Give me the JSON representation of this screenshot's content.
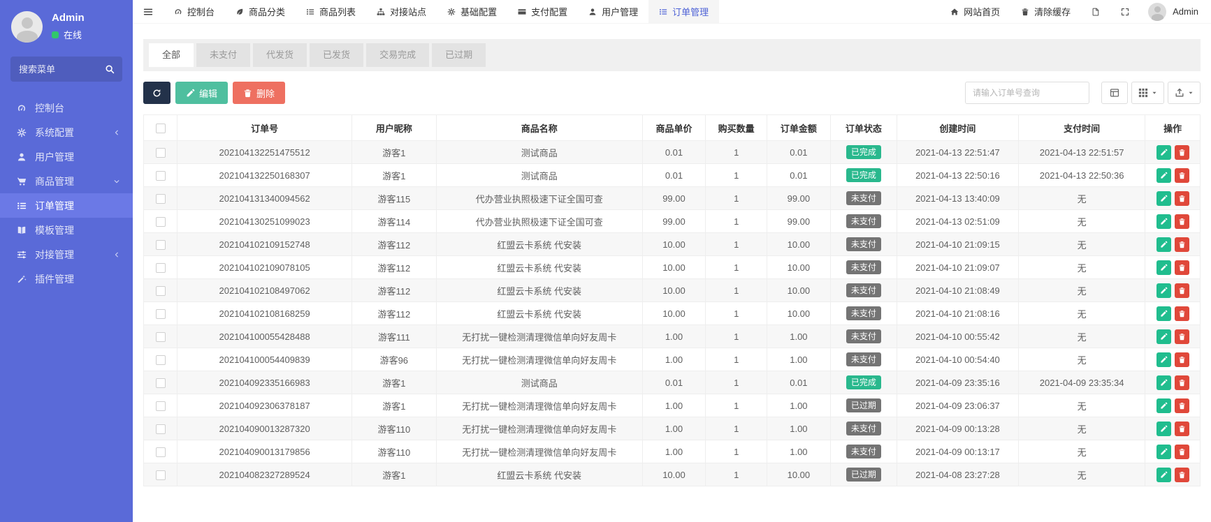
{
  "colors": {
    "sidebar_bg": "#5a6ad8",
    "sidebar_active_bg": "#6b79e6",
    "topbar_active_text": "#4f63d6",
    "success_badge": "#29b88d",
    "gray_badge": "#747474",
    "edit_button": "#4fbf9f",
    "delete_button": "#ee7061",
    "refresh_button": "#23324a",
    "action_edit": "#20bd8e",
    "action_delete": "#e0483a",
    "online_dot": "#31c76b"
  },
  "sidebar": {
    "user": {
      "name": "Admin",
      "status": "在线"
    },
    "search_placeholder": "搜索菜单",
    "items": [
      {
        "key": "console",
        "label": "控制台",
        "icon": "dashboard-icon",
        "arrow": "none",
        "active": false
      },
      {
        "key": "system-config",
        "label": "系统配置",
        "icon": "gear-icon",
        "arrow": "left",
        "active": false
      },
      {
        "key": "user-manage",
        "label": "用户管理",
        "icon": "user-icon",
        "arrow": "none",
        "active": false
      },
      {
        "key": "goods-manage",
        "label": "商品管理",
        "icon": "cart-icon",
        "arrow": "down",
        "active": false
      },
      {
        "key": "order-manage",
        "label": "订单管理",
        "icon": "list-icon",
        "arrow": "none",
        "active": true
      },
      {
        "key": "template-manage",
        "label": "模板管理",
        "icon": "book-icon",
        "arrow": "none",
        "active": false
      },
      {
        "key": "integration-manage",
        "label": "对接管理",
        "icon": "sliders-icon",
        "arrow": "left",
        "active": false
      },
      {
        "key": "plugin-manage",
        "label": "插件管理",
        "icon": "wand-icon",
        "arrow": "none",
        "active": false
      }
    ]
  },
  "topbar": {
    "menu": [
      {
        "key": "console",
        "label": "控制台",
        "icon": "dashboard-icon",
        "active": false
      },
      {
        "key": "goods-category",
        "label": "商品分类",
        "icon": "category-icon",
        "active": false
      },
      {
        "key": "goods-list",
        "label": "商品列表",
        "icon": "list-icon",
        "active": false
      },
      {
        "key": "sites",
        "label": "对接站点",
        "icon": "sitemap-icon",
        "active": false
      },
      {
        "key": "base-config",
        "label": "基础配置",
        "icon": "gear-icon",
        "active": false
      },
      {
        "key": "pay-config",
        "label": "支付配置",
        "icon": "card-icon",
        "active": false
      },
      {
        "key": "user-manage",
        "label": "用户管理",
        "icon": "user-icon",
        "active": false
      },
      {
        "key": "order-manage",
        "label": "订单管理",
        "icon": "list-icon",
        "active": true
      }
    ],
    "right": {
      "home_label": "网站首页",
      "clear_cache_label": "清除缓存",
      "user_label": "Admin"
    }
  },
  "tabs": [
    {
      "key": "all",
      "label": "全部",
      "active": true
    },
    {
      "key": "unpaid",
      "label": "未支付",
      "active": false
    },
    {
      "key": "to-ship",
      "label": "代发货",
      "active": false
    },
    {
      "key": "shipped",
      "label": "已发货",
      "active": false
    },
    {
      "key": "completed",
      "label": "交易完成",
      "active": false
    },
    {
      "key": "expired",
      "label": "已过期",
      "active": false
    }
  ],
  "toolbar": {
    "edit_label": "编辑",
    "delete_label": "删除",
    "search_placeholder": "请输入订单号查询"
  },
  "table": {
    "columns": [
      "订单号",
      "用户昵称",
      "商品名称",
      "商品单价",
      "购买数量",
      "订单金额",
      "订单状态",
      "创建时间",
      "支付时间",
      "操作"
    ],
    "rows": [
      {
        "order_no": "202104132251475512",
        "nickname": "游客1",
        "product": "测试商品",
        "price": "0.01",
        "qty": "1",
        "amount": "0.01",
        "status": "已完成",
        "status_type": "done",
        "created": "2021-04-13 22:51:47",
        "paid": "2021-04-13 22:51:57"
      },
      {
        "order_no": "202104132250168307",
        "nickname": "游客1",
        "product": "测试商品",
        "price": "0.01",
        "qty": "1",
        "amount": "0.01",
        "status": "已完成",
        "status_type": "done",
        "created": "2021-04-13 22:50:16",
        "paid": "2021-04-13 22:50:36"
      },
      {
        "order_no": "202104131340094562",
        "nickname": "游客115",
        "product": "代办营业执照极速下证全国可查",
        "price": "99.00",
        "qty": "1",
        "amount": "99.00",
        "status": "未支付",
        "status_type": "unpaid",
        "created": "2021-04-13 13:40:09",
        "paid": "无"
      },
      {
        "order_no": "202104130251099023",
        "nickname": "游客114",
        "product": "代办营业执照极速下证全国可查",
        "price": "99.00",
        "qty": "1",
        "amount": "99.00",
        "status": "未支付",
        "status_type": "unpaid",
        "created": "2021-04-13 02:51:09",
        "paid": "无"
      },
      {
        "order_no": "202104102109152748",
        "nickname": "游客112",
        "product": "红盟云卡系统 代安装",
        "price": "10.00",
        "qty": "1",
        "amount": "10.00",
        "status": "未支付",
        "status_type": "unpaid",
        "created": "2021-04-10 21:09:15",
        "paid": "无"
      },
      {
        "order_no": "202104102109078105",
        "nickname": "游客112",
        "product": "红盟云卡系统 代安装",
        "price": "10.00",
        "qty": "1",
        "amount": "10.00",
        "status": "未支付",
        "status_type": "unpaid",
        "created": "2021-04-10 21:09:07",
        "paid": "无"
      },
      {
        "order_no": "202104102108497062",
        "nickname": "游客112",
        "product": "红盟云卡系统 代安装",
        "price": "10.00",
        "qty": "1",
        "amount": "10.00",
        "status": "未支付",
        "status_type": "unpaid",
        "created": "2021-04-10 21:08:49",
        "paid": "无"
      },
      {
        "order_no": "202104102108168259",
        "nickname": "游客112",
        "product": "红盟云卡系统 代安装",
        "price": "10.00",
        "qty": "1",
        "amount": "10.00",
        "status": "未支付",
        "status_type": "unpaid",
        "created": "2021-04-10 21:08:16",
        "paid": "无"
      },
      {
        "order_no": "202104100055428488",
        "nickname": "游客111",
        "product": "无打扰一键检测清理微信单向好友周卡",
        "price": "1.00",
        "qty": "1",
        "amount": "1.00",
        "status": "未支付",
        "status_type": "unpaid",
        "created": "2021-04-10 00:55:42",
        "paid": "无"
      },
      {
        "order_no": "202104100054409839",
        "nickname": "游客96",
        "product": "无打扰一键检测清理微信单向好友周卡",
        "price": "1.00",
        "qty": "1",
        "amount": "1.00",
        "status": "未支付",
        "status_type": "unpaid",
        "created": "2021-04-10 00:54:40",
        "paid": "无"
      },
      {
        "order_no": "202104092335166983",
        "nickname": "游客1",
        "product": "测试商品",
        "price": "0.01",
        "qty": "1",
        "amount": "0.01",
        "status": "已完成",
        "status_type": "done",
        "created": "2021-04-09 23:35:16",
        "paid": "2021-04-09 23:35:34"
      },
      {
        "order_no": "202104092306378187",
        "nickname": "游客1",
        "product": "无打扰一键检测清理微信单向好友周卡",
        "price": "1.00",
        "qty": "1",
        "amount": "1.00",
        "status": "已过期",
        "status_type": "expired",
        "created": "2021-04-09 23:06:37",
        "paid": "无"
      },
      {
        "order_no": "202104090013287320",
        "nickname": "游客110",
        "product": "无打扰一键检测清理微信单向好友周卡",
        "price": "1.00",
        "qty": "1",
        "amount": "1.00",
        "status": "未支付",
        "status_type": "unpaid",
        "created": "2021-04-09 00:13:28",
        "paid": "无"
      },
      {
        "order_no": "202104090013179856",
        "nickname": "游客110",
        "product": "无打扰一键检测清理微信单向好友周卡",
        "price": "1.00",
        "qty": "1",
        "amount": "1.00",
        "status": "未支付",
        "status_type": "unpaid",
        "created": "2021-04-09 00:13:17",
        "paid": "无"
      },
      {
        "order_no": "202104082327289524",
        "nickname": "游客1",
        "product": "红盟云卡系统 代安装",
        "price": "10.00",
        "qty": "1",
        "amount": "10.00",
        "status": "已过期",
        "status_type": "expired",
        "created": "2021-04-08 23:27:28",
        "paid": "无"
      }
    ]
  }
}
